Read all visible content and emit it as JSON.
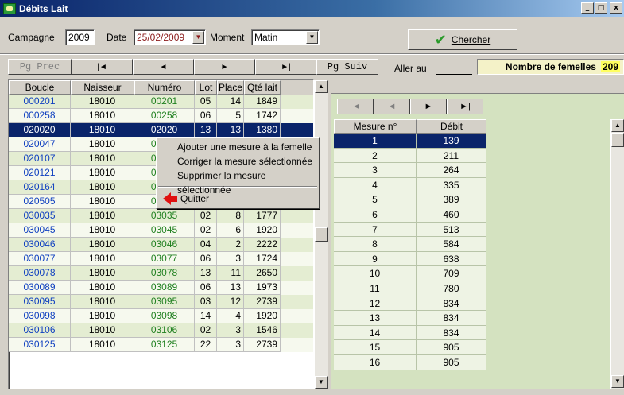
{
  "window": {
    "title": "Débits Lait",
    "minimize": "_",
    "maximize": "□",
    "close": "x"
  },
  "filters": {
    "campagne_label": "Campagne",
    "campagne_value": "2009",
    "date_label": "Date",
    "date_value": "25/02/2009",
    "moment_label": "Moment",
    "moment_value": "Matin"
  },
  "search_button": {
    "label": "Chercher"
  },
  "nav": {
    "pg_prec": "Pg Prec",
    "first": "|◄",
    "prev": "◄",
    "next": "►",
    "last": "►|",
    "pg_suiv": "Pg Suiv",
    "aller_au": "Aller au",
    "aller_au_value": ""
  },
  "femelles": {
    "label": "Nombre de femelles",
    "count": "209"
  },
  "grid": {
    "columns": [
      "Boucle",
      "Naisseur",
      "Numéro",
      "Lot",
      "Place",
      "Qté lait"
    ],
    "rows": [
      [
        "000201",
        "18010",
        "00201",
        "05",
        "14",
        "1849"
      ],
      [
        "000258",
        "18010",
        "00258",
        "06",
        "5",
        "1742"
      ],
      [
        "020020",
        "18010",
        "02020",
        "13",
        "13",
        "1380"
      ],
      [
        "020047",
        "18010",
        "02047",
        "",
        "",
        ""
      ],
      [
        "020107",
        "18010",
        "02107",
        "",
        "",
        ""
      ],
      [
        "020121",
        "18010",
        "02121",
        "",
        "",
        ""
      ],
      [
        "020164",
        "18010",
        "02164",
        "",
        "",
        ""
      ],
      [
        "020505",
        "18010",
        "02505",
        "01",
        "3",
        "2347"
      ],
      [
        "030035",
        "18010",
        "03035",
        "02",
        "8",
        "1777"
      ],
      [
        "030045",
        "18010",
        "03045",
        "02",
        "6",
        "1920"
      ],
      [
        "030046",
        "18010",
        "03046",
        "04",
        "2",
        "2222"
      ],
      [
        "030077",
        "18010",
        "03077",
        "06",
        "3",
        "1724"
      ],
      [
        "030078",
        "18010",
        "03078",
        "13",
        "11",
        "2650"
      ],
      [
        "030089",
        "18010",
        "03089",
        "06",
        "13",
        "1973"
      ],
      [
        "030095",
        "18010",
        "03095",
        "03",
        "12",
        "2739"
      ],
      [
        "030098",
        "18010",
        "03098",
        "14",
        "4",
        "1920"
      ],
      [
        "030106",
        "18010",
        "03106",
        "02",
        "3",
        "1546"
      ],
      [
        "030125",
        "18010",
        "03125",
        "22",
        "3",
        "2739"
      ]
    ]
  },
  "measures": {
    "nav": [
      "|◄",
      "◄",
      "►",
      "►|"
    ],
    "columns": [
      "Mesure n°",
      "Débit"
    ],
    "rows": [
      [
        "1",
        "139"
      ],
      [
        "2",
        "211"
      ],
      [
        "3",
        "264"
      ],
      [
        "4",
        "335"
      ],
      [
        "5",
        "389"
      ],
      [
        "6",
        "460"
      ],
      [
        "7",
        "513"
      ],
      [
        "8",
        "584"
      ],
      [
        "9",
        "638"
      ],
      [
        "10",
        "709"
      ],
      [
        "11",
        "780"
      ],
      [
        "12",
        "834"
      ],
      [
        "13",
        "834"
      ],
      [
        "14",
        "834"
      ],
      [
        "15",
        "905"
      ],
      [
        "16",
        "905"
      ]
    ]
  },
  "context_menu": {
    "items": [
      "Ajouter une mesure à la femelle",
      "Corriger la mesure sélectionnée",
      "Supprimer la mesure sélectionnée"
    ],
    "quit": "Quitter"
  }
}
